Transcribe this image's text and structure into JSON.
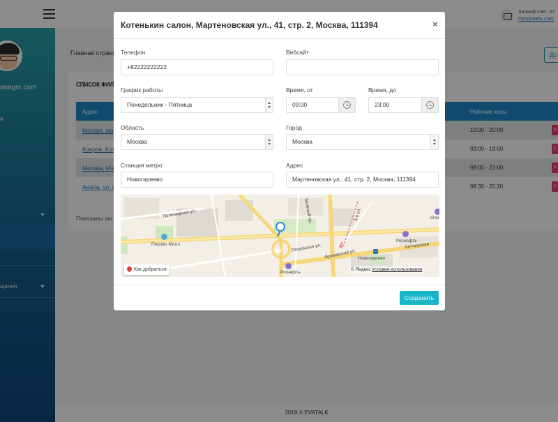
{
  "topbar": {
    "account_label": "Личный счет: 67",
    "topup_link": "Пополнить счет"
  },
  "sidebar": {
    "email": "anager.com",
    "items": [
      {
        "label": "и"
      },
      {
        "label": "щения"
      }
    ]
  },
  "main": {
    "breadcrumb": "Главная страни",
    "add_button": "До",
    "panel_title": "СПИСОК ФИЛ",
    "columns": {
      "address": "Адрес",
      "hours": "Рабочие часы"
    },
    "rows": [
      {
        "address": "Москва, мо",
        "hours": "10:00 - 20:00",
        "action": "у"
      },
      {
        "address": "Ковров, Кот",
        "hours": "09:00 - 19:00",
        "action": "у"
      },
      {
        "address": "Москва, Ма",
        "hours": "09:00 - 23:00",
        "action": "у"
      },
      {
        "address": "Анапа, ул. К",
        "hours": "09:30 - 20:30",
        "action": "у"
      }
    ],
    "shown_text": "Показаны заг"
  },
  "footer": {
    "text": "2019 © EVATALK"
  },
  "modal": {
    "title": "Котенькин салон, Мартеновская ул., 41, стр. 2, Москва, 111394",
    "close": "×",
    "phone": {
      "label": "Телефон",
      "value": "+82222222222"
    },
    "website": {
      "label": "Вебсайт",
      "value": ""
    },
    "schedule": {
      "label": "График работы",
      "value": "Понедельник - Пятница"
    },
    "time_from": {
      "label": "Время, от",
      "value": "09:00"
    },
    "time_to": {
      "label": "Время, до",
      "value": "23:00"
    },
    "region": {
      "label": "Область",
      "value": "Москва"
    },
    "city": {
      "label": "Город",
      "value": "Москва"
    },
    "metro": {
      "label": "Станция метро",
      "value": "Новогиреево"
    },
    "address": {
      "label": "Адрес",
      "value": "Мартеновская ул., 41, стр. 2, Москва, 111394"
    },
    "map": {
      "route_button": "Как добраться",
      "copyright": "© Яндекс",
      "terms": "Условия использования",
      "labels": [
        "Полимерная ул.",
        "Перово Молл",
        "Перовская ул.",
        "Фрязевская ул.",
        "Кетчерская",
        "Новогиреево",
        "Роснефть",
        "Роснефть",
        "Оли",
        "Зеленый пр.",
        "3-я ул."
      ]
    },
    "save_button": "Сохранить"
  },
  "colors": {
    "primary_blue": "#1e88c9",
    "save_teal": "#1bb5c8",
    "delete_pink": "#e63d6e",
    "link_blue": "#1e6fb8"
  }
}
